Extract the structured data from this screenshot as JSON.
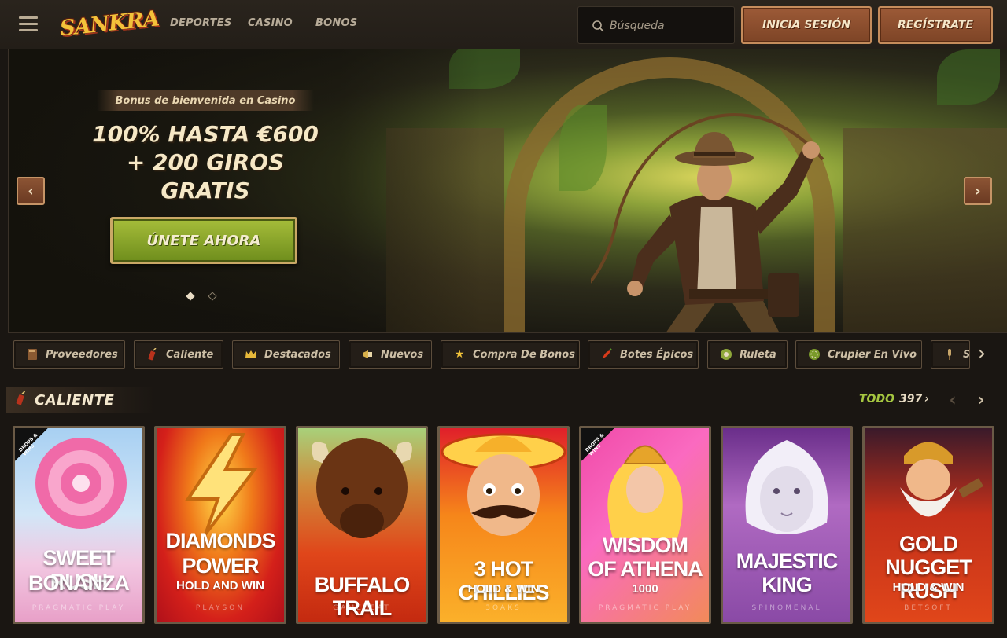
{
  "header": {
    "logo_text": "SANKRA",
    "nav": [
      "DEPORTES",
      "CASINO",
      "BONOS"
    ],
    "search_placeholder": "Búsqueda",
    "login_label": "INICIA SESIÓN",
    "register_label": "REGÍSTRATE"
  },
  "hero": {
    "tag": "Bonus de bienvenida en Casino",
    "title_line1": "100% HASTA €600",
    "title_line2": "+ 200 GIROS",
    "title_line3": "GRATIS",
    "cta_label": "ÚNETE AHORA",
    "prev_arrow": "‹",
    "next_arrow": "›"
  },
  "categories": [
    {
      "label": "Proveedores",
      "icon": "book-icon"
    },
    {
      "label": "Caliente",
      "icon": "dynamite-icon"
    },
    {
      "label": "Destacados",
      "icon": "crown-icon"
    },
    {
      "label": "Nuevos",
      "icon": "megaphone-icon"
    },
    {
      "label": "Compra De Bonos",
      "icon": "star-icon"
    },
    {
      "label": "Botes Épicos",
      "icon": "chili-icon"
    },
    {
      "label": "Ruleta",
      "icon": "roulette-icon"
    },
    {
      "label": "Crupier En Vivo",
      "icon": "chip-icon"
    },
    {
      "label": "S",
      "icon": "microphone-icon"
    }
  ],
  "section": {
    "title": "CALIENTE",
    "all_label": "TODO",
    "all_count": "397",
    "chevron": "›"
  },
  "games": [
    {
      "name1": "SWEET RUSH",
      "name2": "BONANZA",
      "sub": "",
      "provider": "PRAGMATIC PLAY",
      "badge": "DROPS & WINS"
    },
    {
      "name1": "DIAMONDS",
      "name2": "POWER",
      "sub": "HOLD AND WIN",
      "provider": "PLAYSON",
      "badge": ""
    },
    {
      "name1": "BUFFALO TRAIL",
      "name2": "",
      "sub": "",
      "provider": "GAMEBEAT",
      "badge": ""
    },
    {
      "name1": "3 HOT CHILLIES",
      "name2": "",
      "sub": "HOLD & WIN",
      "provider": "3OAKS",
      "badge": ""
    },
    {
      "name1": "WISDOM",
      "name2": "OF ATHENA",
      "sub": "1000",
      "provider": "PRAGMATIC PLAY",
      "badge": "DROPS & WINS"
    },
    {
      "name1": "MAJESTIC",
      "name2": "KING",
      "sub": "",
      "provider": "SPINOMENAL",
      "badge": ""
    },
    {
      "name1": "GOLD",
      "name2": "NUGGET RUSH",
      "sub": "HOLD & WIN",
      "provider": "BETSOFT",
      "badge": ""
    }
  ],
  "colors": {
    "background": "#1a1612",
    "accent_green": "#a5c640",
    "button_copper": "#9c5a37",
    "gold": "#f3c23a"
  }
}
